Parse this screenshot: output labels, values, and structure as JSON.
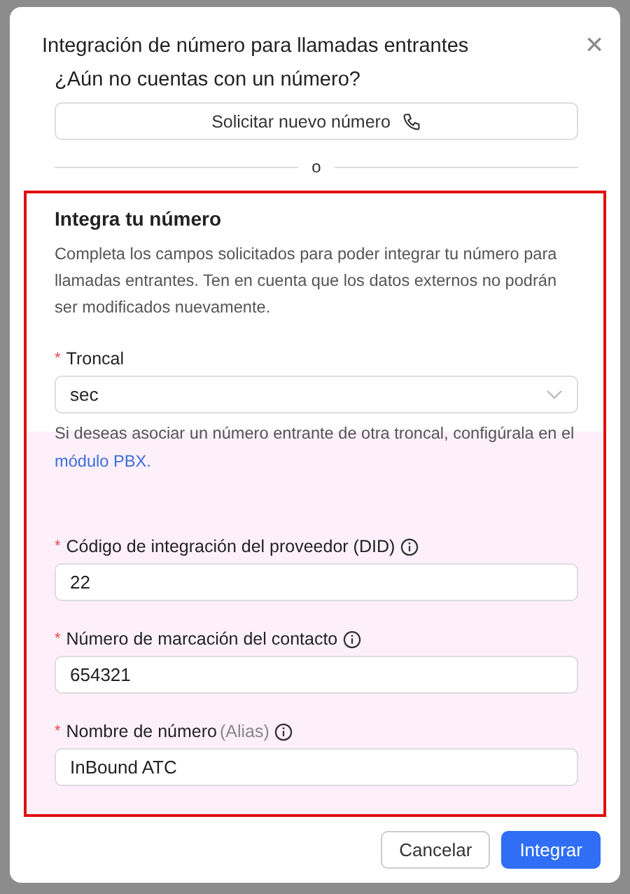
{
  "dialog": {
    "title": "Integración de número para llamadas entrantes",
    "close": "×"
  },
  "request": {
    "question": "¿Aún no cuentas con un número?",
    "button": "Solicitar nuevo número"
  },
  "divider_text": "o",
  "integrate": {
    "heading": "Integra tu número",
    "description": "Completa los campos solicitados para poder integrar tu número para llamadas entrantes. Ten en cuenta que los datos externos no podrán ser modificados nuevamente.",
    "fields": [
      {
        "kind": "select",
        "required": "*",
        "label": "Troncal",
        "value": "sec",
        "help": "Si deseas asociar un número entrante de otra troncal, configúrala en el",
        "help_link": "módulo PBX."
      },
      {
        "kind": "input",
        "required": "*",
        "label": "Código de integración del proveedor (DID)",
        "info": true,
        "value": "22"
      },
      {
        "kind": "input",
        "required": "*",
        "label": "Número de marcación del contacto",
        "info": true,
        "value": "654321"
      },
      {
        "kind": "input",
        "required": "*",
        "label": "Nombre de número",
        "hint": "(Alias)",
        "info": true,
        "value": "InBound ATC"
      }
    ]
  },
  "buttons": [
    {
      "kind": "secondary",
      "label": "Cancelar"
    },
    {
      "kind": "primary",
      "label": "Integrar"
    }
  ]
}
